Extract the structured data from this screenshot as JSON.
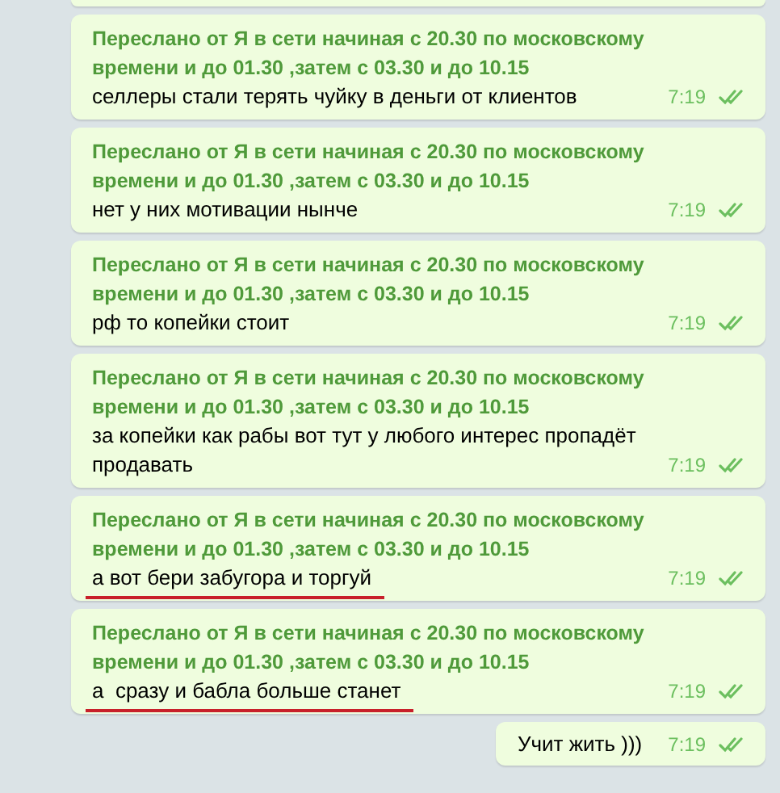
{
  "messages": [
    {
      "kind": "forwarded",
      "header": "Переслано от Я в сети начиная с 20.30 по московскому времени и до 01.30 ,затем с 03.30 и до 10.15",
      "text": "селлеры стали терять чуйку в деньги от клиентов",
      "time": "7:19",
      "read": true,
      "underlined": false
    },
    {
      "kind": "forwarded",
      "header": "Переслано от Я в сети начиная с 20.30 по московскому времени и до 01.30 ,затем с 03.30 и до 10.15",
      "text": "нет у них мотивации нынче",
      "time": "7:19",
      "read": true,
      "underlined": false
    },
    {
      "kind": "forwarded",
      "header": "Переслано от Я в сети начиная с 20.30 по московскому времени и до 01.30 ,затем с 03.30 и до 10.15",
      "text": "рф то копейки стоит",
      "time": "7:19",
      "read": true,
      "underlined": false
    },
    {
      "kind": "forwarded",
      "header": "Переслано от Я в сети начиная с 20.30 по московскому времени и до 01.30 ,затем с 03.30 и до 10.15",
      "text": "за копейки как рабы вот тут у любого интерес пропадёт продавать",
      "time": "7:19",
      "read": true,
      "underlined": false
    },
    {
      "kind": "forwarded",
      "header": "Переслано от Я в сети начиная с 20.30 по московскому времени и до 01.30 ,затем с 03.30 и до 10.15",
      "text": "а вот бери забугора и торгуй",
      "time": "7:19",
      "read": true,
      "underlined": true
    },
    {
      "kind": "forwarded",
      "header": "Переслано от Я в сети начиная с 20.30 по московскому времени и до 01.30 ,затем с 03.30 и до 10.15",
      "text": "а  сразу и бабла больше станет",
      "time": "7:19",
      "read": true,
      "underlined": true
    },
    {
      "kind": "plain",
      "text": "Учит жить )))",
      "time": "7:19",
      "read": true,
      "underlined": false
    }
  ]
}
